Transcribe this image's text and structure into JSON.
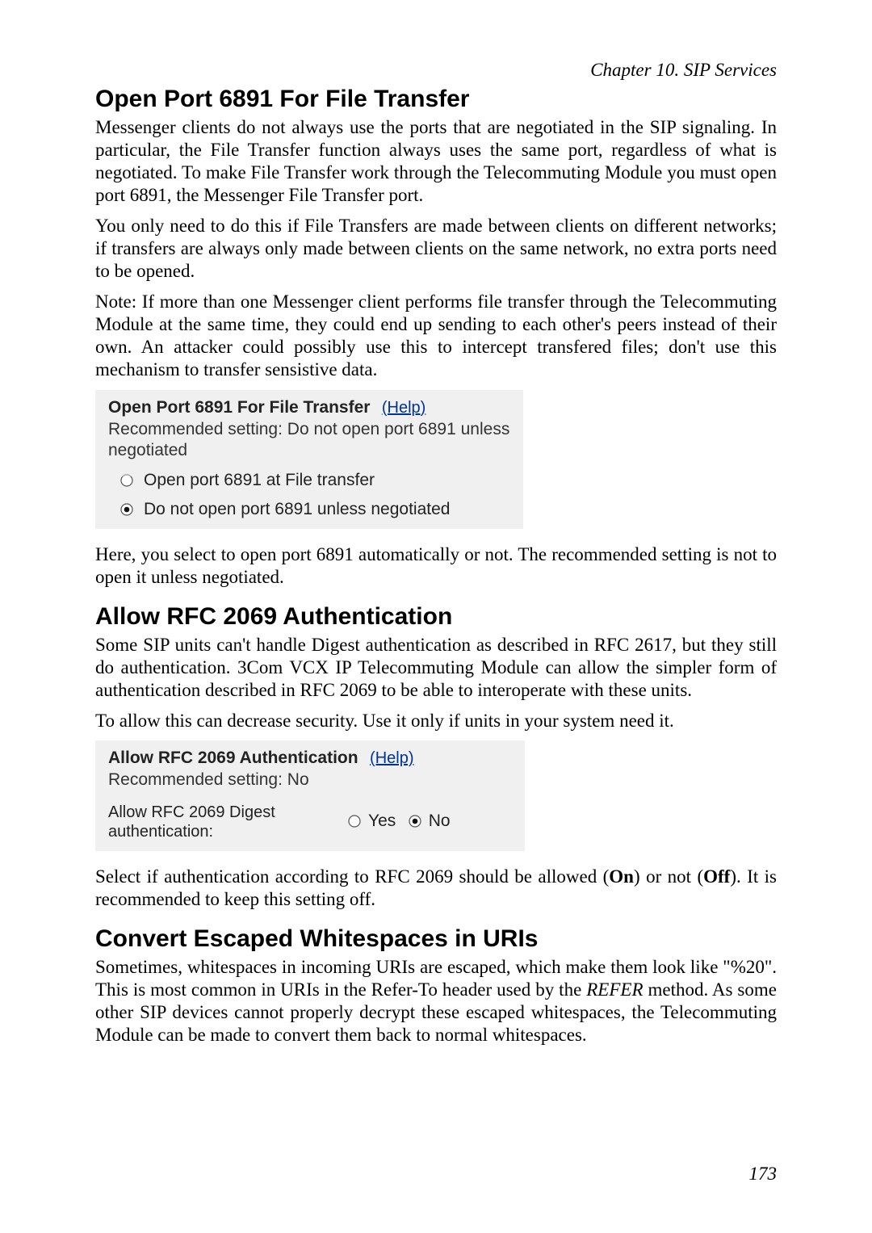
{
  "chapter_line": "Chapter 10. SIP Services",
  "section1": {
    "title": "Open Port 6891 For File Transfer",
    "p1": "Messenger clients do not always use the ports that are negotiated in the SIP signaling. In particular, the File Transfer function always uses the same port, regardless of what is negotiated. To make File Transfer work through the Telecommuting Module you must open port 6891, the Messenger File Transfer port.",
    "p2": "You only need to do this if File Transfers are made between clients on different networks; if transfers are always only made between clients on the same network, no extra ports need to be opened.",
    "p3": "Note: If more than one Messenger client performs file transfer through the Telecommuting Module at the same time, they could end up sending to each other's peers instead of their own. An attacker could possibly use this to intercept transfered files; don't use this mechanism to transfer sensistive data.",
    "card": {
      "title": "Open Port 6891 For File Transfer",
      "help": "(Help)",
      "recommended": "Recommended setting: Do not open port 6891 unless negotiated",
      "opt_open": "Open port 6891 at File transfer",
      "opt_closed": "Do not open port 6891 unless negotiated"
    },
    "p4": "Here, you select to open port 6891 automatically or not. The recommended setting is not to open it unless negotiated."
  },
  "section2": {
    "title": "Allow RFC 2069 Authentication",
    "p1": "Some SIP units can't handle Digest authentication as described in RFC 2617, but they still do authentication. 3Com VCX IP Telecommuting Module can allow the simpler form of authentication described in RFC 2069 to be able to interoperate with these units.",
    "p2": "To allow this can decrease security. Use it only if units in your system need it.",
    "card": {
      "title": "Allow RFC 2069 Authentication",
      "help": "(Help)",
      "recommended": "Recommended setting: No",
      "label": "Allow RFC 2069 Digest authentication:",
      "yes": "Yes",
      "no": "No"
    },
    "p3_a": "Select if authentication according to RFC 2069 should be allowed (",
    "p3_on": "On",
    "p3_b": ") or not (",
    "p3_off": "Off",
    "p3_c": "). It is recommended to keep this setting off."
  },
  "section3": {
    "title": "Convert Escaped Whitespaces in URIs",
    "p1_a": "Sometimes, whitespaces in incoming URIs are escaped, which make them look like \"%20\". This is most common in URIs in the Refer-To header used by the ",
    "p1_refer": "REFER",
    "p1_b": " method. As some other SIP devices cannot properly decrypt these escaped whitespaces, the Telecommuting Module can be made to convert them back to normal whitespaces."
  },
  "page_number": "173"
}
